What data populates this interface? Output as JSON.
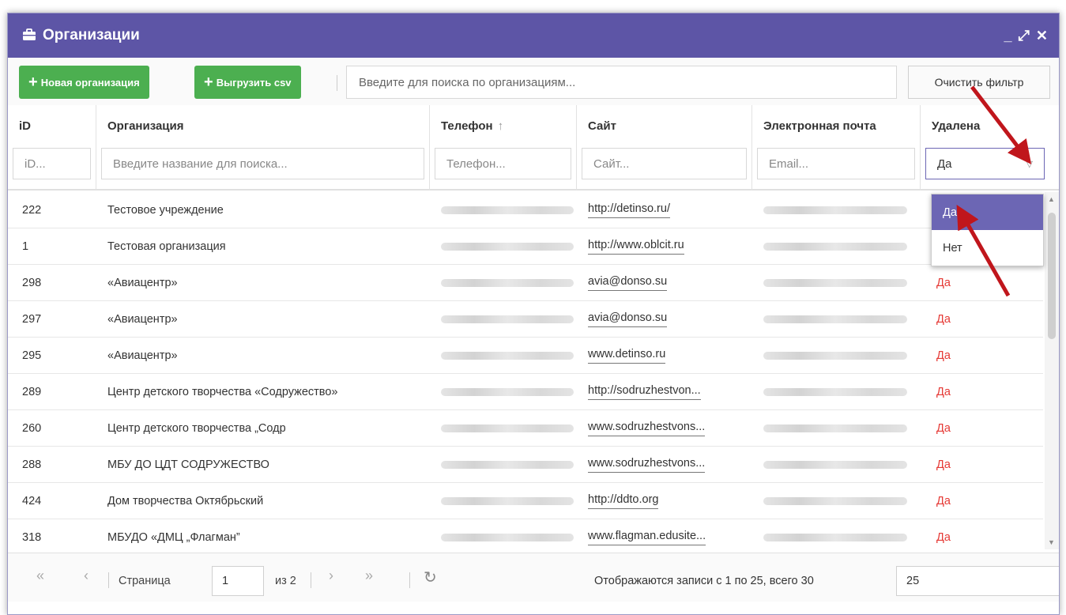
{
  "window": {
    "title": "Организации"
  },
  "toolbar": {
    "new_org": "Новая организация",
    "export_csv": "Выгрузить csv",
    "search_placeholder": "Введите для поиска по организациям...",
    "clear_filter": "Очистить фильтр"
  },
  "columns": [
    {
      "label": "iD",
      "filter": "iD..."
    },
    {
      "label": "Организация",
      "filter": "Введите название для поиска..."
    },
    {
      "label": "Телефон",
      "sort": "↑",
      "filter": "Телефон..."
    },
    {
      "label": "Сайт",
      "filter": "Сайт..."
    },
    {
      "label": "Электронная почта",
      "filter": "Email..."
    },
    {
      "label": "Удалена",
      "filter_value": "Да"
    }
  ],
  "rows": [
    {
      "id": "222",
      "org": "Тестовое учреждение",
      "site": "http://detinso.ru/",
      "deleted": ""
    },
    {
      "id": "1",
      "org": "Тестовая организация",
      "site": "http://www.oblcit.ru",
      "deleted": ""
    },
    {
      "id": "298",
      "org": "«Авиацентр»",
      "site": "avia@donso.su",
      "deleted": "Да"
    },
    {
      "id": "297",
      "org": "«Авиацентр»",
      "site": "avia@donso.su",
      "deleted": "Да"
    },
    {
      "id": "295",
      "org": "«Авиацентр»",
      "site": "www.detinso.ru",
      "deleted": "Да"
    },
    {
      "id": "289",
      "org": "Центр детского творчества «Содружество»",
      "site": "http://sodruzhestvon...",
      "deleted": "Да"
    },
    {
      "id": "260",
      "org": "Центр детского творчества „Содр",
      "site": "www.sodruzhestvons...",
      "deleted": "Да"
    },
    {
      "id": "288",
      "org": "МБУ ДО ЦДТ СОДРУЖЕСТВО",
      "site": "www.sodruzhestvons...",
      "deleted": "Да"
    },
    {
      "id": "424",
      "org": "Дом творчества Октябрьский",
      "site": "http://ddto.org",
      "deleted": "Да"
    },
    {
      "id": "318",
      "org": "МБУДО «ДМЦ „Флагман”",
      "site": "www.flagman.edusite...",
      "deleted": "Да"
    }
  ],
  "dropdown": {
    "options": [
      "Да",
      "Нет"
    ],
    "selected_index": 0
  },
  "pager": {
    "page_label": "Страница",
    "page": "1",
    "of": "из 2",
    "info": "Отображаются записи с 1 по 25, всего 30",
    "page_size": "25"
  },
  "colors": {
    "header": "#5d55a6",
    "green": "#4caf50",
    "deleted": "#e53935",
    "annotation": "#c0161c"
  }
}
